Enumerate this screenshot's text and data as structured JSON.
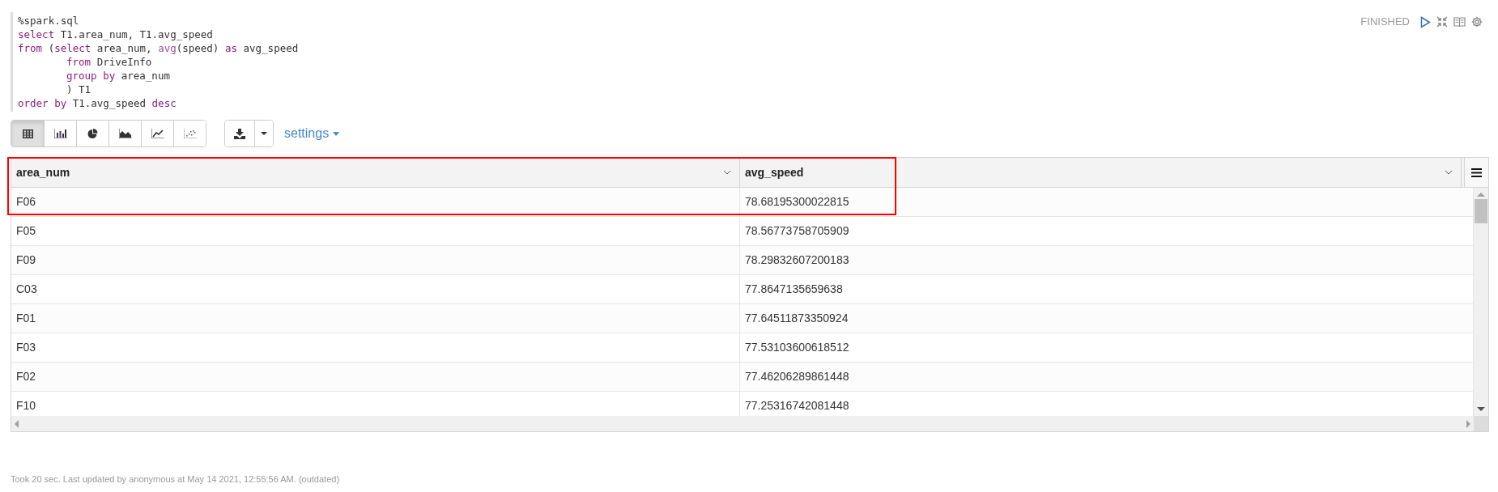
{
  "paragraph": {
    "status": "FINISHED",
    "code_lines": [
      {
        "indented": false,
        "tokens": [
          {
            "text": "%spark.sql",
            "kind": "plain"
          }
        ]
      },
      {
        "indented": false,
        "tokens": [
          {
            "text": "select",
            "kind": "keyword"
          },
          {
            "text": " T1.area_num, T1.avg_speed",
            "kind": "plain"
          }
        ]
      },
      {
        "indented": false,
        "tokens": [
          {
            "text": "from",
            "kind": "keyword"
          },
          {
            "text": " (",
            "kind": "plain"
          },
          {
            "text": "select",
            "kind": "keyword"
          },
          {
            "text": " area_num, ",
            "kind": "plain"
          },
          {
            "text": "avg",
            "kind": "function"
          },
          {
            "text": "(speed) ",
            "kind": "plain"
          },
          {
            "text": "as",
            "kind": "keyword"
          },
          {
            "text": " avg_speed",
            "kind": "plain"
          }
        ]
      },
      {
        "indented": true,
        "tokens": [
          {
            "text": "from",
            "kind": "keyword"
          },
          {
            "text": " DriveInfo",
            "kind": "plain"
          }
        ]
      },
      {
        "indented": true,
        "tokens": [
          {
            "text": "group by",
            "kind": "keyword"
          },
          {
            "text": " area_num",
            "kind": "plain"
          }
        ]
      },
      {
        "indented": true,
        "tokens": [
          {
            "text": ") T1",
            "kind": "plain"
          }
        ]
      },
      {
        "indented": false,
        "tokens": [
          {
            "text": "order by",
            "kind": "keyword"
          },
          {
            "text": " T1.avg_speed ",
            "kind": "plain"
          },
          {
            "text": "desc",
            "kind": "keyword"
          }
        ]
      }
    ],
    "view_buttons": [
      {
        "kind": "table",
        "selected": true
      },
      {
        "kind": "bar",
        "selected": false
      },
      {
        "kind": "pie",
        "selected": false
      },
      {
        "kind": "area",
        "selected": false
      },
      {
        "kind": "line",
        "selected": false
      },
      {
        "kind": "scatter",
        "selected": false
      }
    ],
    "settings_label": "settings",
    "table": {
      "columns": [
        "area_num",
        "avg_speed"
      ],
      "highlight_first_row": true,
      "rows": [
        [
          "F06",
          "78.68195300022815"
        ],
        [
          "F05",
          "78.56773758705909"
        ],
        [
          "F09",
          "78.29832607200183"
        ],
        [
          "C03",
          "77.8647135659638"
        ],
        [
          "F01",
          "77.64511873350924"
        ],
        [
          "F03",
          "77.53103600618512"
        ],
        [
          "F02",
          "77.46206289861448"
        ],
        [
          "F10",
          "77.25316742081448"
        ]
      ]
    },
    "footer": "Took 20 sec. Last updated by anonymous at May 14 2021, 12:55:56 AM. (outdated)"
  }
}
